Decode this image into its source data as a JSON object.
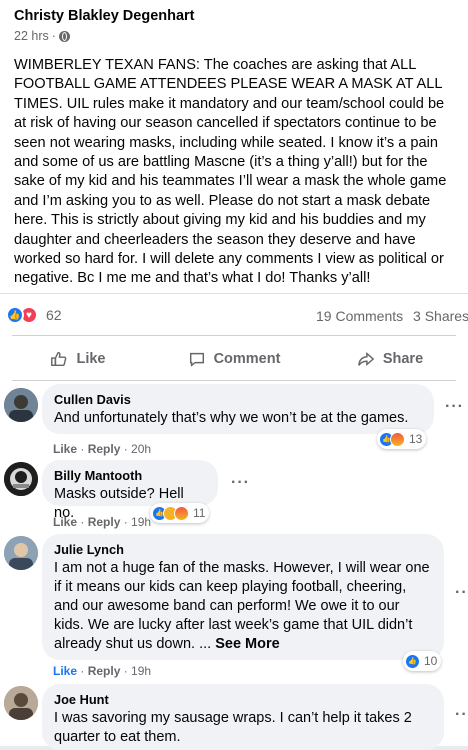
{
  "post": {
    "author": "Christy Blakley Degenhart",
    "time": "22 hrs",
    "separator": "·",
    "text": "WIMBERLEY TEXAN FANS: The coaches are asking that ALL FOOTBALL GAME ATTENDEES PLEASE WEAR A MASK AT ALL TIMES. UIL rules make it mandatory and our team/school could be at risk of having our season cancelled if spectators continue to be seen not wearing masks, including while seated. I know it’s a pain and some of us are battling Mascne (it’s a thing y’all!) but for the sake of my kid and his teammates I’ll wear a mask the whole game and I’m asking you to as well. Please do not start a mask debate here. This is strictly about giving my kid and his buddies and my daughter and cheerleaders the season they deserve and have worked so hard for. I will delete any comments I view as political or negative. Bc I me me and that’s what I do! Thanks y’all!",
    "reaction_count": "62",
    "comments_count": "19 Comments",
    "shares_count": "3 Shares"
  },
  "actions": {
    "like": "Like",
    "comment": "Comment",
    "share": "Share"
  },
  "comments": [
    {
      "name": "Cullen Davis",
      "text": "And unfortunately that’s why we won’t be at the games.",
      "like": "Like",
      "reply": "Reply",
      "time": "20h",
      "reactions": "13",
      "avatar_color": "#5a6b7c"
    },
    {
      "name": "Billy Mantooth",
      "text": "Masks outside? Hell no.",
      "like": "Like",
      "reply": "Reply",
      "time": "19h",
      "reactions": "11",
      "avatar_color": "#2b2b2b"
    },
    {
      "name": "Julie Lynch",
      "text": "I am not a huge fan of the masks. However, I will wear one if it means our kids can keep playing football, cheering, and our awesome band can perform! We owe it to our kids. We are lucky after last week’s game that UIL didn’t already shut us down. ...",
      "see_more": "See More",
      "like": "Like",
      "reply": "Reply",
      "time": "19h",
      "reactions": "10",
      "avatar_color": "#7a8fa3"
    },
    {
      "name": "Joe Hunt",
      "text": "I was savoring my sausage wraps. I can’t help it takes 2 quarter to eat them.",
      "avatar_color": "#8a7a6a"
    }
  ],
  "colors": {
    "facebook_blue": "#1877f2",
    "love_red": "#f33e58",
    "secondary_text": "#65676b",
    "bubble_bg": "#f0f2f5"
  },
  "icons": {
    "globe": "globe-icon",
    "like": "thumbs-up-icon",
    "comment": "speech-bubble-icon",
    "share": "share-arrow-icon",
    "more": "more-dots-icon"
  }
}
